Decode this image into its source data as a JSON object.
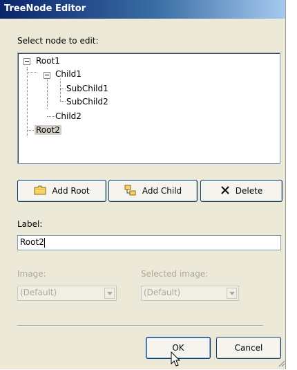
{
  "window": {
    "title": "TreeNode Editor"
  },
  "labels": {
    "select_node": "Select node to edit:",
    "label": "Label:",
    "image": "Image:",
    "selected_image": "Selected image:"
  },
  "tree": {
    "root1": "Root1",
    "child1": "Child1",
    "subchild1": "SubChild1",
    "subchild2": "SubChild2",
    "child2": "Child2",
    "root2": "Root2",
    "selected": "Root2"
  },
  "buttons": {
    "add_root": "Add Root",
    "add_child": "Add Child",
    "delete": "Delete",
    "ok": "OK",
    "cancel": "Cancel"
  },
  "fields": {
    "label_value": "Root2",
    "image_value": "(Default)",
    "selected_image_value": "(Default)"
  },
  "icons": {
    "add_root": "folder-icon",
    "add_child": "add-child-icon",
    "delete": "delete-x-icon"
  },
  "colors": {
    "dialog_bg": "#ece9d8",
    "title_start": "#0a246a",
    "title_end": "#a6caf0",
    "field_border": "#7f9db9"
  }
}
